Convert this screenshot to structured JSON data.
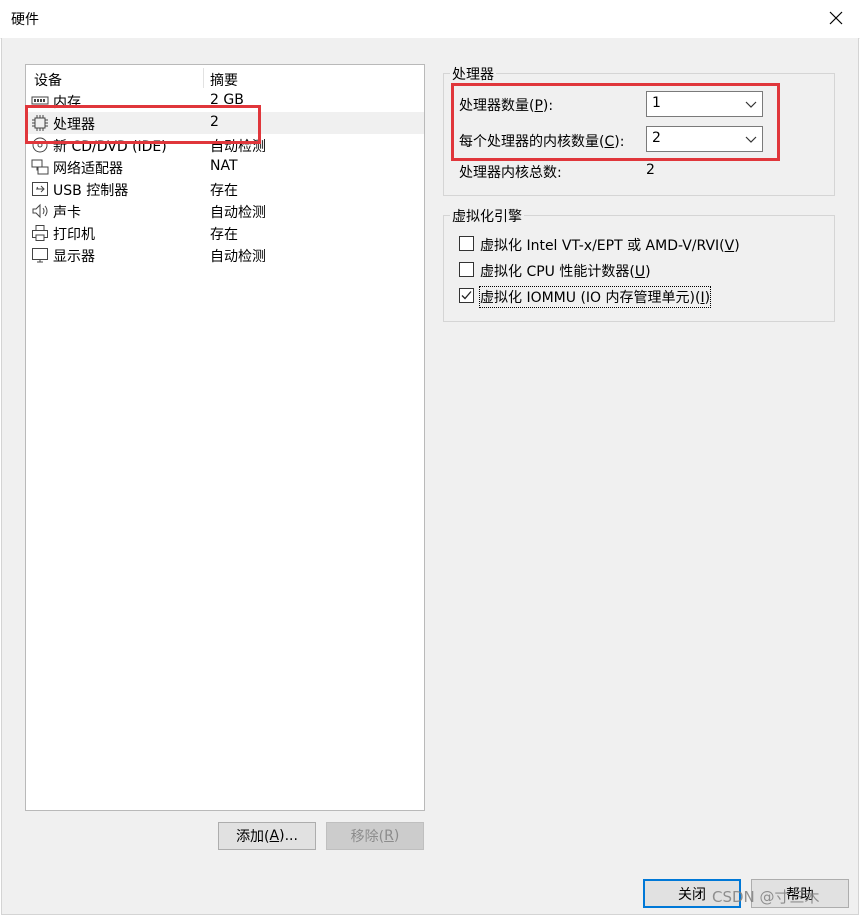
{
  "window": {
    "title": "硬件",
    "close_icon": "close-icon"
  },
  "device_list": {
    "columns": [
      "设备",
      "摘要"
    ],
    "rows": [
      {
        "icon": "memory-icon",
        "name": "内存",
        "summary": "2 GB"
      },
      {
        "icon": "processor-icon",
        "name": "处理器",
        "summary": "2",
        "selected": true
      },
      {
        "icon": "cd-dvd-icon",
        "name": "新 CD/DVD (IDE)",
        "summary": "自动检测"
      },
      {
        "icon": "network-adapter-icon",
        "name": "网络适配器",
        "summary": "NAT"
      },
      {
        "icon": "usb-icon",
        "name": "USB 控制器",
        "summary": "存在"
      },
      {
        "icon": "sound-icon",
        "name": "声卡",
        "summary": "自动检测"
      },
      {
        "icon": "printer-icon",
        "name": "打印机",
        "summary": "存在"
      },
      {
        "icon": "display-icon",
        "name": "显示器",
        "summary": "自动检测"
      }
    ]
  },
  "buttons": {
    "add_prefix": "添加(",
    "add_key": "A",
    "add_suffix": ")...",
    "remove_prefix": "移除(",
    "remove_key": "R",
    "remove_suffix": ")",
    "close": "关闭",
    "help": "帮助"
  },
  "processor_group": {
    "title": "处理器",
    "count_prefix": "处理器数量(",
    "count_key": "P",
    "count_suffix": "):",
    "count_value": "1",
    "cores_prefix": "每个处理器的内核数量(",
    "cores_key": "C",
    "cores_suffix": "):",
    "cores_value": "2",
    "total_label": "处理器内核总数:",
    "total_value": "2"
  },
  "virtualization_group": {
    "title": "虚拟化引擎",
    "vtx_prefix": "虚拟化 Intel VT-x/EPT 或 AMD-V/RVI(",
    "vtx_key": "V",
    "vtx_suffix": ")",
    "vtx_checked": false,
    "cpu_counter_prefix": "虚拟化 CPU 性能计数器(",
    "cpu_counter_key": "U",
    "cpu_counter_suffix": ")",
    "cpu_counter_checked": false,
    "iommu_prefix": "虚拟化 IOMMU (IO 内存管理单元)(",
    "iommu_key": "I",
    "iommu_suffix": ")",
    "iommu_checked": true
  },
  "watermark": "CSDN @寸三木",
  "colors": {
    "highlight_box": "#e0363b",
    "accent": "#0078d7"
  }
}
